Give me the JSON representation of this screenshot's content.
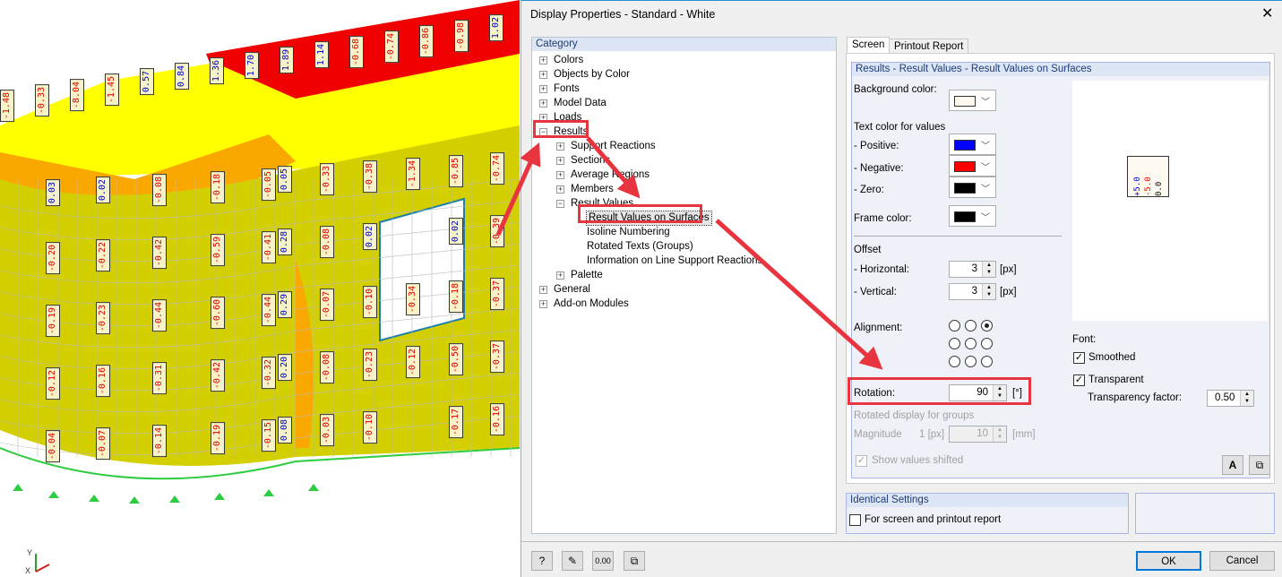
{
  "viewport": {
    "axis_labels": {
      "y": "Y",
      "x": "X"
    },
    "colors": {
      "wall": "#d4cf00",
      "orange": "#f9a800",
      "yellow": "#ffff00",
      "red": "#f00000"
    },
    "value_columns": [
      [
        "0.03",
        "-0.20",
        "-0.19",
        "-0.12",
        "-0.04"
      ],
      [
        "0.02",
        "-0.22",
        "-0.23",
        "-0.16",
        "-0.07"
      ],
      [
        "-0.08",
        "-0.42",
        "-0.44",
        "-0.31",
        "-0.14"
      ],
      [
        "-0.18",
        "-0.59",
        "-0.60",
        "-0.42",
        "-0.19"
      ],
      [
        "-0.05",
        "-0.41",
        "-0.44",
        "-0.32",
        "-0.15"
      ],
      [
        "0.05",
        "0.28",
        "0.29",
        "0.20",
        "0.08"
      ],
      [
        "-0.33",
        "-0.08",
        "-0.07",
        "-0.08",
        "-0.03"
      ],
      [
        "-0.38",
        "0.02",
        "-0.10",
        "-0.23",
        "-0.10"
      ],
      [
        "-1.34",
        "",
        "-0.34",
        "-0.12",
        ""
      ],
      [
        "-0.85",
        "0.02",
        "-0.18",
        "-0.50",
        "-0.17"
      ],
      [
        "-0.74",
        "-0.39",
        "-0.37",
        "-0.37",
        "-0.16"
      ]
    ],
    "top_values": [
      "-1.48",
      "-0.33",
      "-8.04",
      "-1.45",
      "0.57",
      "0.84",
      "1.36",
      "1.70",
      "1.89",
      "1.14",
      "-0.68",
      "-0.74",
      "-0.86",
      "-0.98",
      "1.02"
    ]
  },
  "dialog": {
    "title": "Display Properties - Standard - White",
    "category_header": "Category",
    "tree": [
      {
        "label": "Colors",
        "level": 0,
        "toggle": "+"
      },
      {
        "label": "Objects by Color",
        "level": 0,
        "toggle": "+"
      },
      {
        "label": "Fonts",
        "level": 0,
        "toggle": "+"
      },
      {
        "label": "Model Data",
        "level": 0,
        "toggle": "+"
      },
      {
        "label": "Loads",
        "level": 0,
        "toggle": "+"
      },
      {
        "label": "Results",
        "level": 0,
        "toggle": "−"
      },
      {
        "label": "Support Reactions",
        "level": 1,
        "toggle": "+"
      },
      {
        "label": "Sections",
        "level": 1,
        "toggle": "+"
      },
      {
        "label": "Average Regions",
        "level": 1,
        "toggle": "+"
      },
      {
        "label": "Members",
        "level": 1,
        "toggle": "+"
      },
      {
        "label": "Result Values",
        "level": 1,
        "toggle": "−"
      },
      {
        "label": "Result Values on Surfaces",
        "level": 2,
        "selected": true
      },
      {
        "label": "Isoline Numbering",
        "level": 2
      },
      {
        "label": "Rotated Texts (Groups)",
        "level": 2
      },
      {
        "label": "Information on Line Support Reactions",
        "level": 2
      },
      {
        "label": "Palette",
        "level": 1,
        "toggle": "+"
      },
      {
        "label": "General",
        "level": 0,
        "toggle": "+"
      },
      {
        "label": "Add-on Modules",
        "level": 0,
        "toggle": "+"
      }
    ],
    "tabs": [
      "Screen",
      "Printout Report"
    ],
    "section_header": "Results - Result Values - Result Values on Surfaces",
    "background_color_label": "Background color:",
    "background_color": "#fffaf0",
    "text_color_label": "Text color for values",
    "positive_label": "- Positive:",
    "positive_color": "#0000ff",
    "negative_label": "- Negative:",
    "negative_color": "#ff0000",
    "zero_label": "- Zero:",
    "zero_color": "#000000",
    "frame_color_label": "Frame color:",
    "frame_color": "#000000",
    "offset_label": "Offset",
    "horizontal_label": "- Horizontal:",
    "horizontal_value": "3",
    "vertical_label": "- Vertical:",
    "vertical_value": "3",
    "px_unit": "[px]",
    "alignment_label": "Alignment:",
    "alignment_selected": "top-right",
    "rotation_label": "Rotation:",
    "rotation_value": "90",
    "rotation_unit": "[°]",
    "rotated_groups_label": "Rotated display for groups",
    "magnitude_label": "Magnitude",
    "magnitude_px": "1 [px]",
    "magnitude_value": "10",
    "mm_unit": "[mm]",
    "show_shifted_label": "Show values shifted",
    "show_shifted_checked": true,
    "preview": {
      "positive": "+5.0",
      "negative": "-5.0",
      "zero": "0.0"
    },
    "font_label": "Font:",
    "smoothed_label": "Smoothed",
    "smoothed_checked": true,
    "transparent_label": "Transparent",
    "transparent_checked": true,
    "transparency_factor_label": "Transparency factor:",
    "transparency_factor": "0.50",
    "identical_header": "Identical Settings",
    "identical_label": "For screen and printout report",
    "identical_checked": false,
    "ok_label": "OK",
    "cancel_label": "Cancel",
    "annotation_color": "#e8343e"
  }
}
